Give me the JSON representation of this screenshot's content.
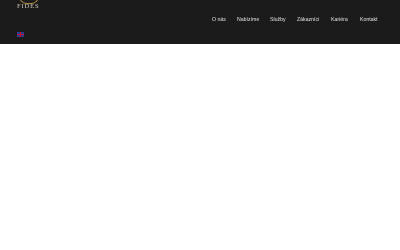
{
  "brand": {
    "logo_text": "FIDES"
  },
  "nav": {
    "items": [
      {
        "label": "O nás"
      },
      {
        "label": "Nabízíme"
      },
      {
        "label": "Služby"
      },
      {
        "label": "Zákazníci"
      },
      {
        "label": "Kariéra"
      },
      {
        "label": "Kontakt"
      }
    ]
  },
  "language": {
    "icon": "uk-flag-icon"
  },
  "colors": {
    "header_bg": "#1b1b1b",
    "logo_accent": "#b8924a",
    "nav_text": "#e8e8e8",
    "page_bg": "#ffffff"
  }
}
